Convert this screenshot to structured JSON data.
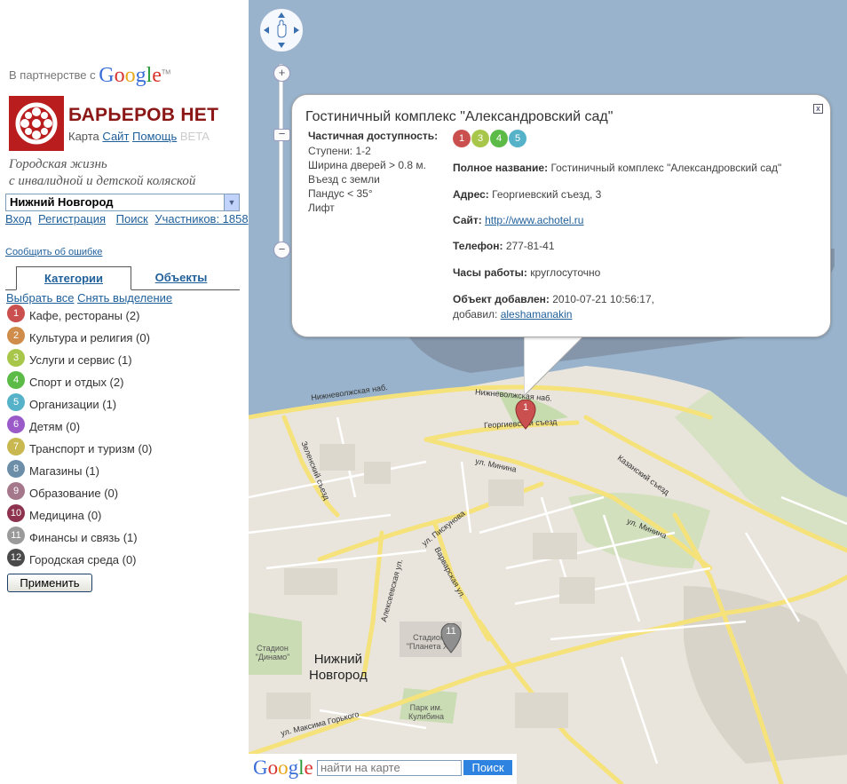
{
  "sidebar": {
    "partner": {
      "text": "В партнерстве с",
      "google": "Google",
      "tm": "TM"
    },
    "brand": {
      "title": "БАРЬЕРОВ НЕТ",
      "map_label": "Карта",
      "site_link": "Сайт",
      "help_link": "Помощь",
      "beta": "BETA"
    },
    "tagline_1": "Городская жизнь",
    "tagline_2": "с инвалидной и детской коляской",
    "city_select": "Нижний Новгород",
    "login": "Вход",
    "register": "Регистрация",
    "search": "Поиск",
    "participants": "Участников: 1858",
    "report_error": "Сообщить об ошибке",
    "tabs": {
      "categories": "Категории",
      "objects": "Объекты"
    },
    "select_all": "Выбрать все",
    "deselect": "Снять выделение",
    "categories": [
      {
        "num": "1",
        "label": "Кафе, рестораны (2)",
        "color": "#c9504f"
      },
      {
        "num": "2",
        "label": "Культура и религия (0)",
        "color": "#cf8c4a"
      },
      {
        "num": "3",
        "label": "Услуги и сервис (1)",
        "color": "#a8c74a"
      },
      {
        "num": "4",
        "label": "Спорт и отдых (2)",
        "color": "#5cbb46"
      },
      {
        "num": "5",
        "label": "Организации (1)",
        "color": "#56b2c9"
      },
      {
        "num": "6",
        "label": "Детям (0)",
        "color": "#9a5bc9"
      },
      {
        "num": "7",
        "label": "Транспорт и туризм (0)",
        "color": "#c8b84f"
      },
      {
        "num": "8",
        "label": "Магазины (1)",
        "color": "#6c8ea8"
      },
      {
        "num": "9",
        "label": "Образование (0)",
        "color": "#a4788a"
      },
      {
        "num": "10",
        "label": "Медицина (0)",
        "color": "#8d3350"
      },
      {
        "num": "11",
        "label": "Финансы и связь (1)",
        "color": "#9a9a9a"
      },
      {
        "num": "12",
        "label": "Городская среда (0)",
        "color": "#4a4a4a"
      }
    ],
    "apply_button": "Применить"
  },
  "map": {
    "labels": {
      "nizhnevolzhskaya_1": "Нижневолжская наб.",
      "nizhnevolzhskaya_2": "Нижневолжская наб.",
      "georgievsky": "Георгиевский съезд",
      "zelensky": "Зеленский съезд",
      "minina_1": "ул. Минина",
      "minina_2": "ул. Минина",
      "kazansky": "Казанский съезд",
      "piskunova": "ул. Пискунова",
      "alekseevskaya": "Алексеевская ул.",
      "varvarskaya": "Варварская ул.",
      "gorkogo": "ул. Максима Горького",
      "stadium_dinamo": "Стадион \"Динамо\"",
      "stadium_planeta": "Стадион \"Планета Х\"",
      "park": "Парк им. Кулибина",
      "city_1": "Нижний",
      "city_2": "Новгород"
    },
    "pin_1": "1",
    "pin_11": "11",
    "search_placeholder": "найти на карте",
    "search_button": "Поиск",
    "google_logo": "Google"
  },
  "info": {
    "title": "Гостиничный комплекс \"Александровский сад\"",
    "close": "x",
    "accessibility_label": "Частичная доступность:",
    "accessibility_items": [
      "Ступени: 1-2",
      "Ширина дверей > 0.8 м.",
      "Въезд с земли",
      "Пандус < 35°",
      "Лифт"
    ],
    "access_dots": [
      {
        "num": "1",
        "color": "#c9504f"
      },
      {
        "num": "3",
        "color": "#a8c74a"
      },
      {
        "num": "4",
        "color": "#5cbb46"
      },
      {
        "num": "5",
        "color": "#56b2c9"
      }
    ],
    "full_name_label": "Полное название:",
    "full_name": "Гостиничный комплекс \"Александровский сад\"",
    "address_label": "Адрес:",
    "address": "Георгиевский съезд, 3",
    "site_label": "Сайт:",
    "site": "http://www.achotel.ru",
    "phone_label": "Телефон:",
    "phone": "277-81-41",
    "hours_label": "Часы работы:",
    "hours": "круглосуточно",
    "added_label": "Объект добавлен:",
    "added": "2010-07-21 10:56:17,",
    "added_by_label": "добавил:",
    "added_by": "aleshamanakin"
  }
}
